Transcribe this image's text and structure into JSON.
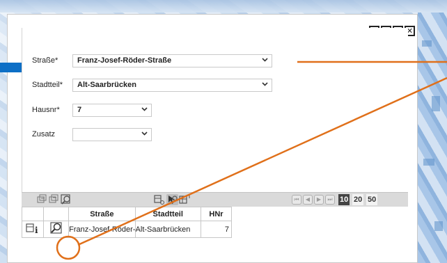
{
  "window": {
    "controls": [
      {
        "name": "help",
        "glyph": "?"
      },
      {
        "name": "minimize",
        "glyph": ""
      },
      {
        "name": "maximize",
        "glyph": ""
      },
      {
        "name": "close",
        "glyph": "✕"
      }
    ]
  },
  "form": {
    "strasse": {
      "label": "Straße*",
      "value": "Franz-Josef-Röder-Straße"
    },
    "stadtteil": {
      "label": "Stadtteil*",
      "value": "Alt-Saarbrücken"
    },
    "hausnr": {
      "label": "Hausnr*",
      "value": "7"
    },
    "zusatz": {
      "label": "Zusatz",
      "value": ""
    }
  },
  "toolbar": {
    "page_sizes": [
      "10",
      "20",
      "50"
    ],
    "active_page_size": "10"
  },
  "table": {
    "columns": [
      "",
      "",
      "Straße",
      "Stadtteil",
      "HNr"
    ],
    "rows": [
      {
        "strasse": "Franz-Josef-Röder-Straße",
        "stadtteil": "Alt-Saarbrücken",
        "hnr": "7"
      }
    ]
  },
  "colors": {
    "accent_blue": "#0d6fc6",
    "annotation_orange": "#e0701a",
    "toolbar_gray": "#dadada"
  }
}
